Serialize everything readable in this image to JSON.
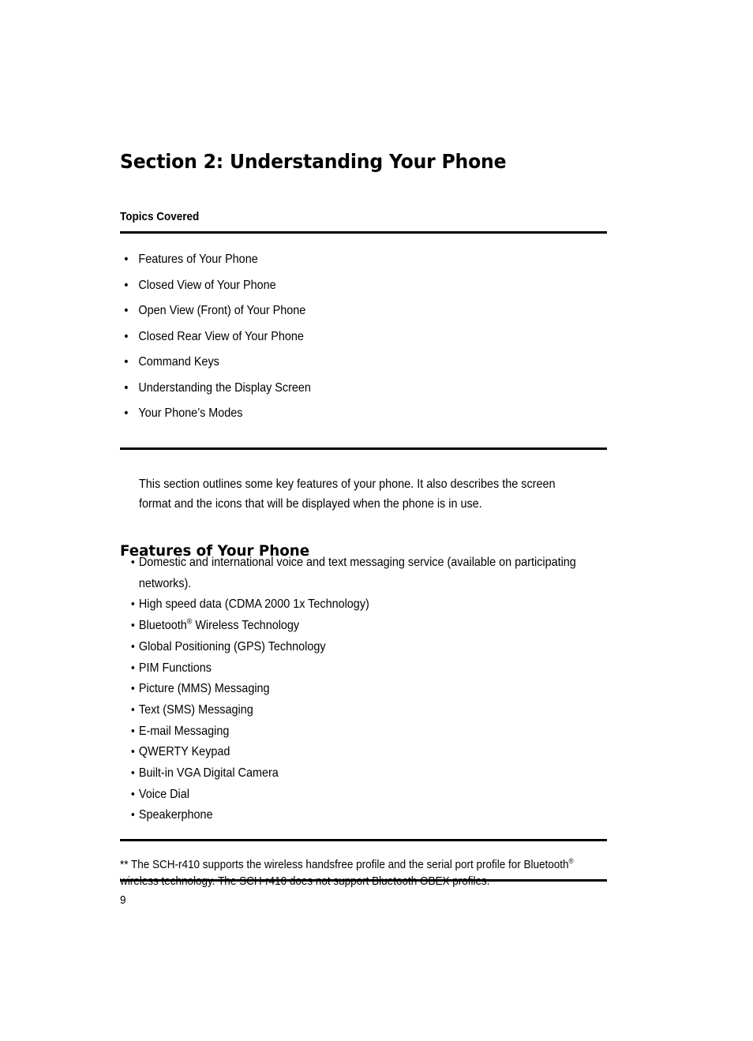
{
  "document": {
    "section_title": "Section 2: Understanding Your Phone",
    "page_number": "9"
  },
  "topics": {
    "label": "Topics Covered",
    "bullet_glyph": "•",
    "items": [
      "Features of Your Phone",
      "Closed View of Your Phone",
      "Open View (Front) of Your Phone",
      "Closed Rear View of Your Phone",
      "Command Keys",
      "Understanding the Display Screen",
      "Your Phone’s Modes"
    ]
  },
  "intro": {
    "paragraph": "This section outlines some key features of your phone. It also describes the screen format and the icons that will be displayed when the phone is in use."
  },
  "features": {
    "heading": "Features of Your Phone",
    "bullet_glyph": "•",
    "items": [
      "Domestic and international voice and text messaging service (available on participating networks).",
      "High speed data (CDMA 2000 1x Technology)",
      "Global Positioning (GPS) Technology",
      "PIM Functions",
      "Picture (MMS) Messaging",
      "Text (SMS) Messaging",
      "E-mail Messaging",
      "QWERTY Keypad",
      "Built-in VGA Digital Camera",
      "Voice Dial",
      "Speakerphone"
    ],
    "bluetooth_item": {
      "name": "Bluetooth",
      "trademark": "®",
      "suffix": " Wireless Technology"
    }
  },
  "footnote": {
    "part1": "** The SCH-r410 supports the wireless handsfree profile and the serial port profile for Bluetooth",
    "trademark": "®",
    "part2": " wireless technology. The SCH-r410 does not support Bluetooth OBEX profiles."
  }
}
